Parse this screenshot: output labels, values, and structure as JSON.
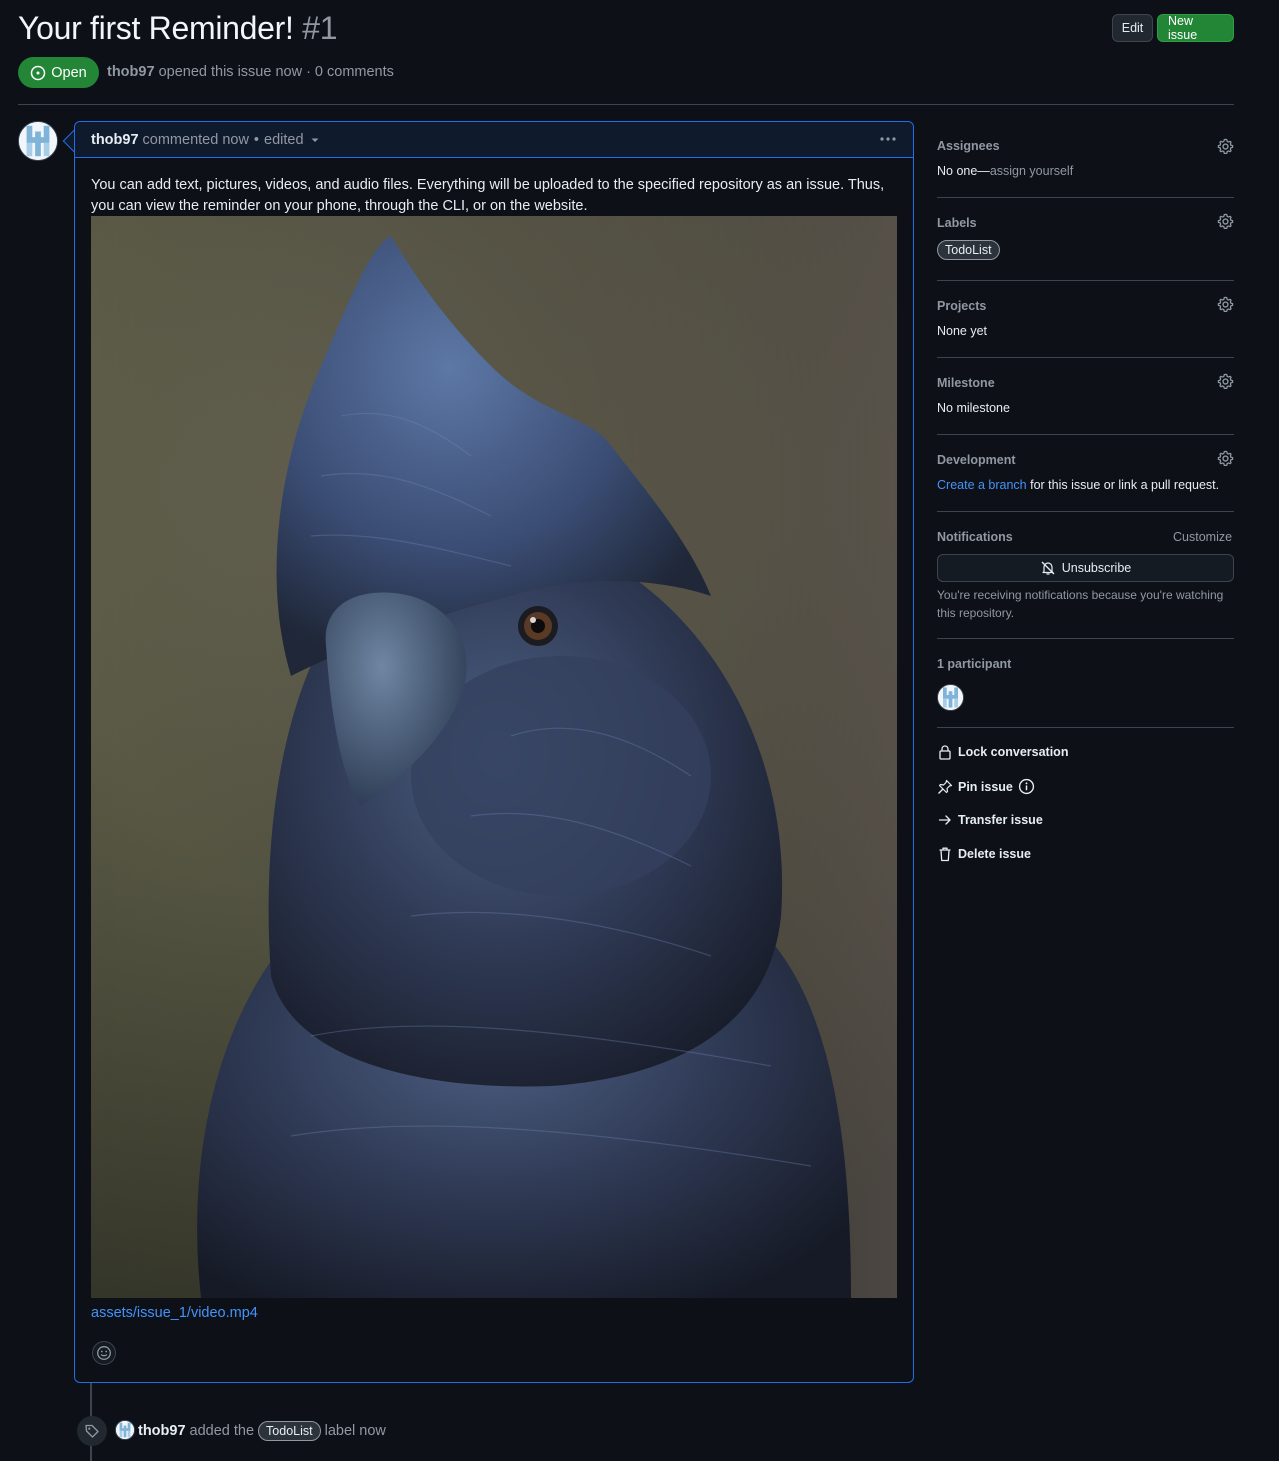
{
  "header": {
    "title": "Your first Reminder!",
    "number": "#1",
    "edit_label": "Edit",
    "new_issue_label": "New issue",
    "state": "Open",
    "author": "thob97",
    "meta_rest": "opened this issue now · 0 comments"
  },
  "comment": {
    "author": "thob97",
    "time": "commented now",
    "sep": "•",
    "edited": "edited",
    "body": "You can add text, pictures, videos, and audio files. Everything will be uploaded to the specified repository as an issue. Thus, you can view the reminder on your phone, through the CLI, or on the website.",
    "asset_link": "assets/issue_1/video.mp4"
  },
  "event": {
    "author": "thob97",
    "pre": "added the",
    "label": "TodoList",
    "post": "label now"
  },
  "sidebar": {
    "assignees": {
      "title": "Assignees",
      "value_pre": "No one—",
      "value_link": "assign yourself"
    },
    "labels": {
      "title": "Labels",
      "chip": "TodoList"
    },
    "projects": {
      "title": "Projects",
      "value": "None yet"
    },
    "milestone": {
      "title": "Milestone",
      "value": "No milestone"
    },
    "development": {
      "title": "Development",
      "link": "Create a branch",
      "rest": "for this issue or link a pull request."
    },
    "notifications": {
      "title": "Notifications",
      "customize": "Customize",
      "button": "Unsubscribe",
      "note": "You're receiving notifications because you're watching this repository."
    },
    "participants": {
      "title": "1 participant"
    },
    "actions": {
      "lock": "Lock conversation",
      "pin": "Pin issue",
      "transfer": "Transfer issue",
      "delete": "Delete issue"
    }
  },
  "colors": {
    "background": "#0d1117",
    "accent_green": "#238636",
    "link_blue": "#4493f8",
    "comment_border": "#1f6feb"
  }
}
